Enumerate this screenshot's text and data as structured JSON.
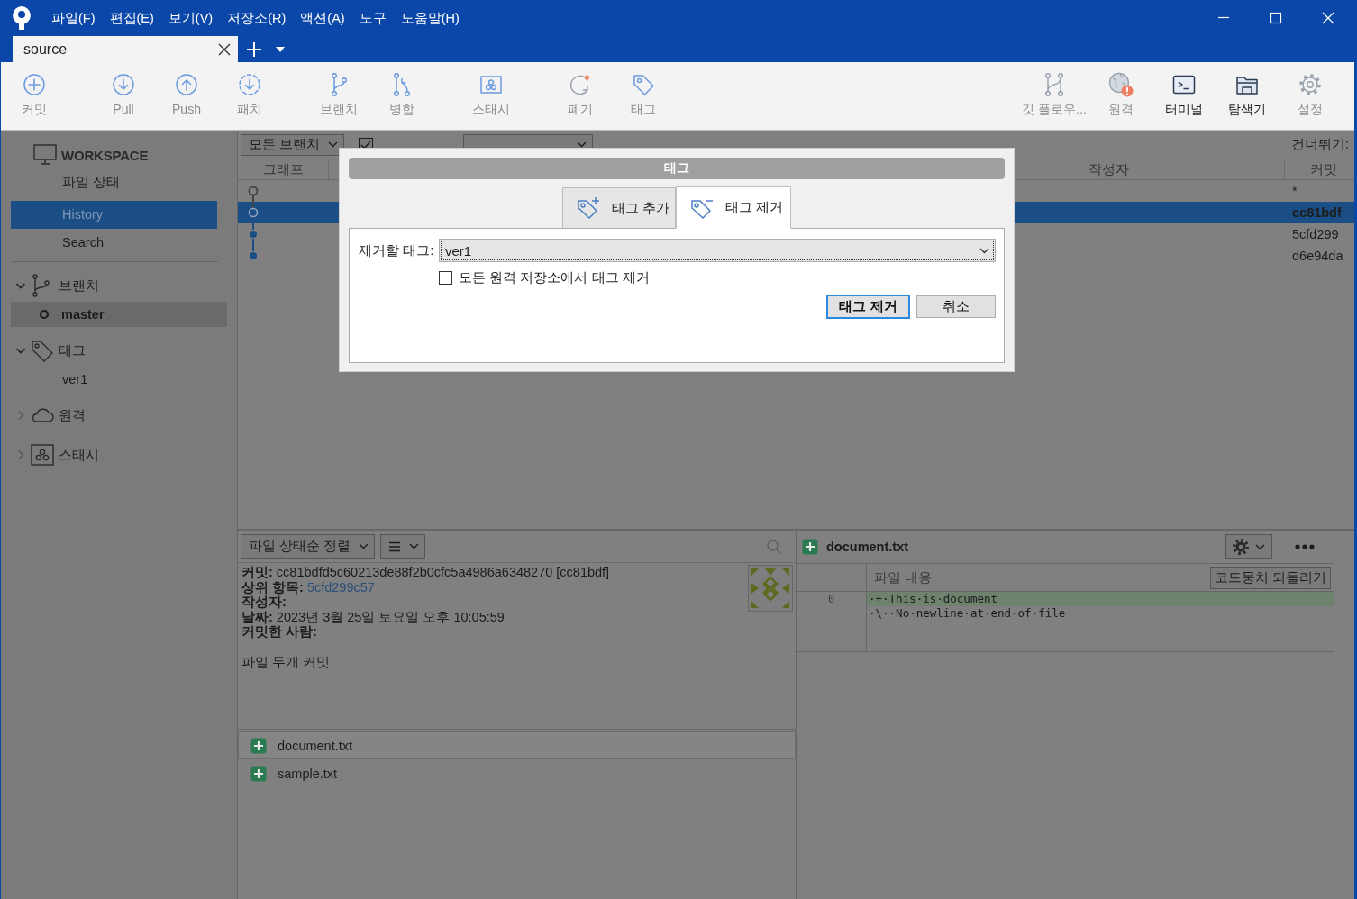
{
  "title_bar": {
    "menus": [
      "파일(F)",
      "편집(E)",
      "보기(V)",
      "저장소(R)",
      "액션(A)",
      "도구",
      "도움말(H)"
    ]
  },
  "tabs": [
    {
      "label": "source",
      "selected": true
    }
  ],
  "toolbar": {
    "left": [
      [
        {
          "kind": "commit",
          "label": "커밋",
          "disabled": true
        }
      ],
      [
        {
          "kind": "pull",
          "label": "Pull",
          "disabled": true
        },
        {
          "kind": "push",
          "label": "Push",
          "disabled": true
        },
        {
          "kind": "fetch",
          "label": "패치",
          "disabled": true
        }
      ],
      [
        {
          "kind": "branch",
          "label": "브랜치",
          "disabled": true
        },
        {
          "kind": "merge",
          "label": "병합",
          "disabled": true
        }
      ],
      [
        {
          "kind": "stash",
          "label": "스태시",
          "disabled": true
        }
      ],
      [
        {
          "kind": "discard",
          "label": "폐기",
          "disabled": true
        },
        {
          "kind": "tag",
          "label": "태그",
          "disabled": true
        }
      ]
    ],
    "right": [
      {
        "kind": "gitflow",
        "label": "깃 플로우...",
        "disabled": true
      },
      {
        "kind": "remote",
        "label": "원격",
        "disabled": true
      },
      {
        "kind": "terminal",
        "label": "터미널",
        "disabled": false
      },
      {
        "kind": "explorer",
        "label": "탐색기",
        "disabled": false
      },
      {
        "kind": "settings",
        "label": "설정",
        "disabled": true
      }
    ]
  },
  "sidebar": {
    "workspace": {
      "title": "WORKSPACE",
      "items": [
        {
          "label": "파일 상태",
          "selected": false
        },
        {
          "label": "History",
          "selected": true
        },
        {
          "label": "Search",
          "selected": false
        }
      ]
    },
    "sections": [
      {
        "kind": "branch",
        "label": "브랜치",
        "expanded": true,
        "children": [
          {
            "label": "master",
            "selected": true,
            "current": true
          }
        ]
      },
      {
        "kind": "tag",
        "label": "태그",
        "expanded": true,
        "children": [
          {
            "label": "ver1",
            "selected": false,
            "current": false
          }
        ]
      },
      {
        "kind": "remote",
        "label": "원격",
        "expanded": false
      },
      {
        "kind": "stash",
        "label": "스태시",
        "expanded": false
      }
    ]
  },
  "history": {
    "filters": {
      "branches": "모든 브랜치",
      "remote_branches": {
        "checked": true
      },
      "skip": "건너뛰기:"
    },
    "columns": [
      "그래프",
      "작성자",
      "커밋"
    ],
    "rows": [
      {
        "kind": "uncommitted",
        "commit": "*",
        "selected": false
      },
      {
        "kind": "commit",
        "commit": "cc81bdf",
        "selected": true
      },
      {
        "kind": "commit",
        "commit": "5cfd299",
        "selected": false
      },
      {
        "kind": "commit",
        "commit": "d6e94da",
        "selected": false
      }
    ]
  },
  "details": {
    "sort": "파일 상태순 정렬",
    "lines": [
      {
        "text": "**커밋:** cc81bdfd5c60213de88f2b0cfc5a4986a6348270 [cc81bdf]"
      },
      {
        "text": "**상위 항목:**",
        "link": "5cfd299c57"
      },
      {
        "text": "**작성자:**"
      },
      {
        "text": "**날짜:** 2023년 3월 25일 토요일 오후 10:05:59"
      },
      {
        "text": "**커밋한 사람:**"
      }
    ],
    "message": "파일 두개 커밋",
    "files": [
      {
        "name": "document.txt",
        "kind": "added",
        "selected": true
      },
      {
        "name": "sample.txt",
        "kind": "added",
        "selected": false
      }
    ]
  },
  "diff": {
    "file": {
      "name": "document.txt",
      "kind": "added"
    },
    "hunk": {
      "title": "파일 내용",
      "button": "코드뭉치 되돌리기"
    },
    "lines": [
      {
        "number": "0",
        "text": "·+·This·is·document",
        "kind": "added"
      },
      {
        "text": "·\\··No·newline·at·end·of·file",
        "kind": "context"
      }
    ]
  },
  "dialog": {
    "title": "태그",
    "tabs": [
      {
        "kind": "add",
        "label": "태그 추가",
        "selected": false
      },
      {
        "kind": "remove",
        "label": "태그 제거",
        "selected": true
      }
    ],
    "tag_field": {
      "label": "제거할 태그:",
      "value": "ver1"
    },
    "remove_remote": {
      "label": "모든 원격 저장소에서 태그 제거",
      "checked": false
    },
    "buttons": [
      {
        "label": "태그 제거",
        "default": true
      },
      {
        "label": "취소",
        "default": false
      }
    ]
  }
}
